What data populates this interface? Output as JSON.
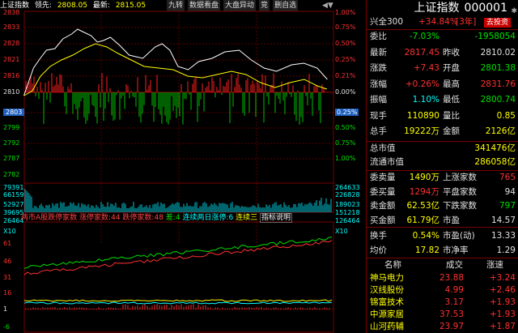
{
  "header": {
    "title": "上证指数",
    "lead_label": "领先:",
    "lead_value": "2808.05",
    "latest_label": "最新:",
    "latest_value": "2815.05",
    "buttons": [
      "九转",
      "数据看盘",
      "大盘异动",
      "竞",
      "删自选"
    ]
  },
  "price_axis": {
    "left": [
      "2838",
      "2833",
      "2828",
      "2821",
      "2816",
      "2810",
      "2803",
      "2799",
      "2792",
      "2787",
      "2782"
    ],
    "right": [
      "1.00%",
      "0.75%",
      "0.50%",
      "0.25%",
      "0.21%",
      "0.00%",
      "0.25%",
      "0.50%",
      "0.75%",
      "1.00%"
    ],
    "highlight_left": "2803",
    "highlight_right": "0.25%"
  },
  "volume_axis": {
    "left": [
      "79391",
      "66159",
      "52927",
      "39695",
      "26464"
    ],
    "right": [
      "264633",
      "226828",
      "189023",
      "151218",
      "126464"
    ],
    "unit": "X10",
    "unit_right": "X10"
  },
  "breadth_bar": {
    "label1": "两市A股跌停家数",
    "label2": "涨停家数:",
    "value2": "44",
    "label3": "跌停家数:",
    "value3": "48",
    "label4": "差:",
    "value4": "4",
    "label5": "连续两日涨停:",
    "value5": "6",
    "label6": "连续三",
    "label7": "指标说明"
  },
  "lower_axis": {
    "left": [
      "61",
      "46",
      "31",
      "16",
      "1",
      "-6"
    ]
  },
  "right_panel": {
    "title": "上证指数",
    "code": "000001",
    "sub": {
      "label": "兴全300",
      "value": "+34.84%",
      "tag": "[3年]",
      "button": "去投资"
    },
    "rows1": [
      {
        "l1": "委比",
        "v1": "-7.03%",
        "l2": "",
        "v2": "-1958054",
        "c1": "green",
        "c2": "green"
      },
      {
        "l1": "最新",
        "v1": "2817.45",
        "l2": "昨收",
        "v2": "2810.02",
        "c1": "red",
        "c2": "white"
      },
      {
        "l1": "涨跌",
        "v1": "+7.43",
        "l2": "开盘",
        "v2": "2801.38",
        "c1": "red",
        "c2": "green"
      },
      {
        "l1": "涨幅",
        "v1": "+0.26%",
        "l2": "最高",
        "v2": "2831.76",
        "c1": "red",
        "c2": "red"
      },
      {
        "l1": "振幅",
        "v1": "1.10%",
        "l2": "最低",
        "v2": "2800.74",
        "c1": "cyan",
        "c2": "green"
      },
      {
        "l1": "现手",
        "v1": "110890",
        "l2": "量比",
        "v2": "0.85",
        "c1": "yellow",
        "c2": "yellow"
      },
      {
        "l1": "总手",
        "v1": "19222万",
        "l2": "金额",
        "v2": "2126亿",
        "c1": "yellow",
        "c2": "yellow"
      }
    ],
    "rows2": [
      {
        "label": "总市值",
        "value": "341476亿"
      },
      {
        "label": "流通市值",
        "value": "286058亿"
      }
    ],
    "rows3": [
      {
        "l1": "委卖量",
        "v1": "1490万",
        "l2": "上涨家数",
        "v2": "765",
        "c1": "yellow",
        "c2": "red"
      },
      {
        "l1": "委买量",
        "v1": "1294万",
        "l2": "平盘家数",
        "v2": "94",
        "c1": "red",
        "c2": "white"
      },
      {
        "l1": "卖金额",
        "v1": "62.53亿",
        "l2": "下跌家数",
        "v2": "797",
        "c1": "yellow",
        "c2": "green"
      },
      {
        "l1": "买金额",
        "v1": "61.79亿",
        "l2": "市盈",
        "v2": "14.57",
        "c1": "yellow",
        "c2": "white"
      }
    ],
    "rows4": [
      {
        "l1": "换手",
        "v1": "0.54%",
        "l2": "市盈(动)",
        "v2": "13.33",
        "c1": "yellow",
        "c2": "white"
      },
      {
        "l1": "均价",
        "v1": "17.82",
        "l2": "市净率",
        "v2": "1.29",
        "c1": "yellow",
        "c2": "white"
      }
    ],
    "list_header": {
      "name": "名称",
      "value": "成交",
      "change": "涨速"
    },
    "list": [
      {
        "name": "神马电力",
        "value": "23.88",
        "change": "+3.24"
      },
      {
        "name": "汉线股份",
        "value": "4.99",
        "change": "+2.46"
      },
      {
        "name": "锦富技术",
        "value": "3.17",
        "change": "+1.93"
      },
      {
        "name": "中源家居",
        "value": "37.53",
        "change": "+1.93"
      },
      {
        "name": "山河药辅",
        "value": "23.97",
        "change": "+1.87"
      }
    ]
  },
  "colors": {
    "up": "#ff3030",
    "down": "#00e000",
    "grid": "#7a0000",
    "price_line": "#ffffff",
    "avg_line": "#ffff00"
  }
}
